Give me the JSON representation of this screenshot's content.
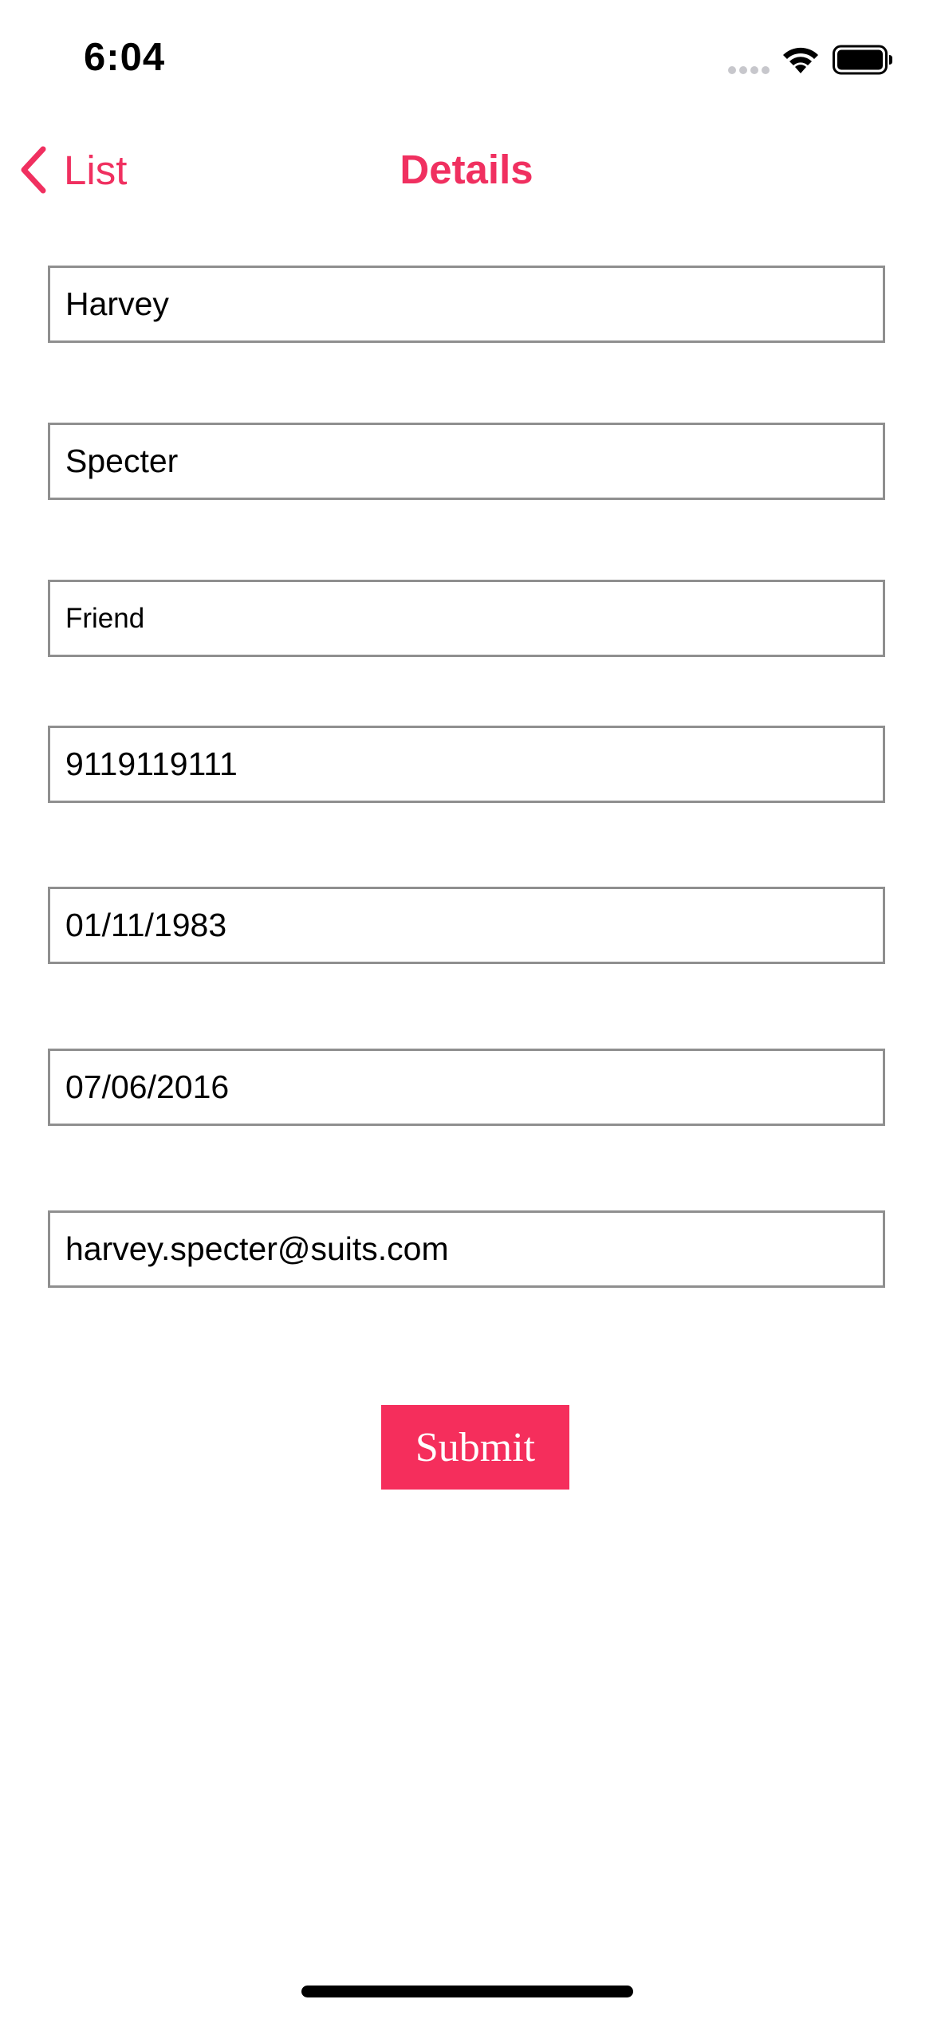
{
  "status_bar": {
    "time": "6:04",
    "icons": [
      "cellular-signal-icon",
      "wifi-icon",
      "battery-icon"
    ]
  },
  "nav": {
    "back_label": "List",
    "title": "Details",
    "back_icon": "chevron-left-icon"
  },
  "form": {
    "first_name": "Harvey",
    "last_name": "Specter",
    "relationship": "Friend",
    "phone": "9119119111",
    "date_of_birth": "01/11/1983",
    "date_2": "07/06/2016",
    "email": "harvey.specter@suits.com",
    "submit_label": "Submit"
  },
  "colors": {
    "accent": "#f03060",
    "button_background": "#f52e5c",
    "field_border": "#8f8f8f"
  }
}
